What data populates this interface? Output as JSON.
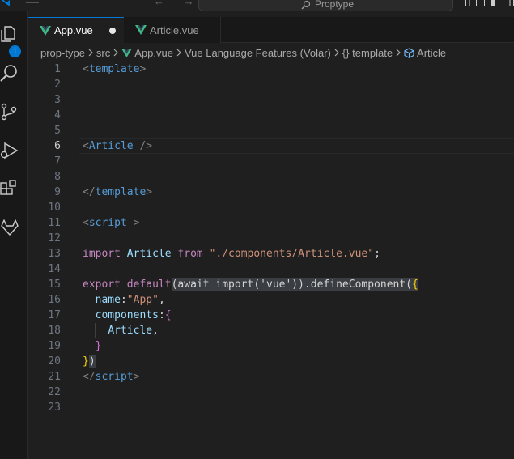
{
  "titlebar": {
    "nav": "← →",
    "search_text": "Proptype"
  },
  "activitybar": {
    "badge": "1"
  },
  "tabs": [
    {
      "label": "App.vue"
    },
    {
      "label": "Article.vue"
    }
  ],
  "breadcrumb": {
    "items": [
      "prop-type",
      "src",
      "App.vue",
      "Vue Language Features (Volar)",
      "{} template",
      "Article"
    ]
  },
  "colors": {
    "vue_green": "#41b883",
    "accent": "#0078d4",
    "tag": "#808080",
    "tagname": "#569cd6",
    "keyword": "#c586c0",
    "variable": "#9cdcfe",
    "string": "#ce9178",
    "function": "#dcdcaa",
    "brace": "#ffd700"
  },
  "editor": {
    "active_line": "6",
    "lines": [
      {
        "n": "1",
        "tokens": [
          {
            "t": "<",
            "c": "#808080"
          },
          {
            "t": "template",
            "c": "#569cd6"
          },
          {
            "t": ">",
            "c": "#808080"
          }
        ]
      },
      {
        "n": "2",
        "tokens": []
      },
      {
        "n": "3",
        "tokens": []
      },
      {
        "n": "4",
        "tokens": []
      },
      {
        "n": "5",
        "tokens": []
      },
      {
        "n": "6",
        "tokens": [
          {
            "t": "<",
            "c": "#808080"
          },
          {
            "t": "Article",
            "c": "#569cd6"
          },
          {
            "t": " ",
            "c": "#d4d4d4"
          },
          {
            "t": "/>",
            "c": "#808080"
          }
        ]
      },
      {
        "n": "7",
        "tokens": []
      },
      {
        "n": "8",
        "tokens": []
      },
      {
        "n": "9",
        "tokens": [
          {
            "t": "</",
            "c": "#808080"
          },
          {
            "t": "template",
            "c": "#569cd6"
          },
          {
            "t": ">",
            "c": "#808080"
          }
        ]
      },
      {
        "n": "10",
        "tokens": []
      },
      {
        "n": "11",
        "tokens": [
          {
            "t": "<",
            "c": "#808080"
          },
          {
            "t": "script",
            "c": "#569cd6"
          },
          {
            "t": " >",
            "c": "#808080"
          }
        ]
      },
      {
        "n": "12",
        "tokens": []
      },
      {
        "n": "13",
        "tokens": [
          {
            "t": "import",
            "c": "#c586c0"
          },
          {
            "t": " ",
            "c": "#d4d4d4"
          },
          {
            "t": "Article",
            "c": "#9cdcfe"
          },
          {
            "t": " ",
            "c": "#d4d4d4"
          },
          {
            "t": "from",
            "c": "#c586c0"
          },
          {
            "t": " ",
            "c": "#d4d4d4"
          },
          {
            "t": "\"./components/Article.vue\"",
            "c": "#ce9178"
          },
          {
            "t": ";",
            "c": "#d4d4d4"
          }
        ]
      },
      {
        "n": "14",
        "tokens": []
      },
      {
        "n": "15",
        "tokens": [
          {
            "t": "export",
            "c": "#c586c0"
          },
          {
            "t": " ",
            "c": "#d4d4d4"
          },
          {
            "t": "default",
            "c": "#c586c0"
          },
          {
            "t": "(await import('vue')).defineComponent(",
            "c": "#d4d4d4",
            "hl": true
          },
          {
            "t": "{",
            "c": "#ffd700",
            "hl": true
          }
        ]
      },
      {
        "n": "16",
        "tokens": [
          {
            "t": "  ",
            "c": "#d4d4d4"
          },
          {
            "t": "name",
            "c": "#9cdcfe"
          },
          {
            "t": ":",
            "c": "#d4d4d4"
          },
          {
            "t": "\"App\"",
            "c": "#ce9178"
          },
          {
            "t": ",",
            "c": "#d4d4d4"
          }
        ]
      },
      {
        "n": "17",
        "tokens": [
          {
            "t": "  ",
            "c": "#d4d4d4"
          },
          {
            "t": "components",
            "c": "#9cdcfe"
          },
          {
            "t": ":",
            "c": "#d4d4d4"
          },
          {
            "t": "{",
            "c": "#da70d6"
          }
        ]
      },
      {
        "n": "18",
        "tokens": [
          {
            "t": "    ",
            "c": "#d4d4d4"
          },
          {
            "t": "Article",
            "c": "#9cdcfe"
          },
          {
            "t": ",",
            "c": "#d4d4d4"
          }
        ]
      },
      {
        "n": "19",
        "tokens": [
          {
            "t": "  ",
            "c": "#d4d4d4"
          },
          {
            "t": "}",
            "c": "#da70d6"
          }
        ]
      },
      {
        "n": "20",
        "tokens": [
          {
            "t": "}",
            "c": "#ffd700"
          },
          {
            "t": ")",
            "c": "#d4d4d4",
            "hl": true
          }
        ]
      },
      {
        "n": "21",
        "tokens": [
          {
            "t": "</",
            "c": "#808080"
          },
          {
            "t": "script",
            "c": "#569cd6"
          },
          {
            "t": ">",
            "c": "#808080"
          }
        ]
      },
      {
        "n": "22",
        "tokens": []
      },
      {
        "n": "23",
        "tokens": []
      }
    ]
  }
}
